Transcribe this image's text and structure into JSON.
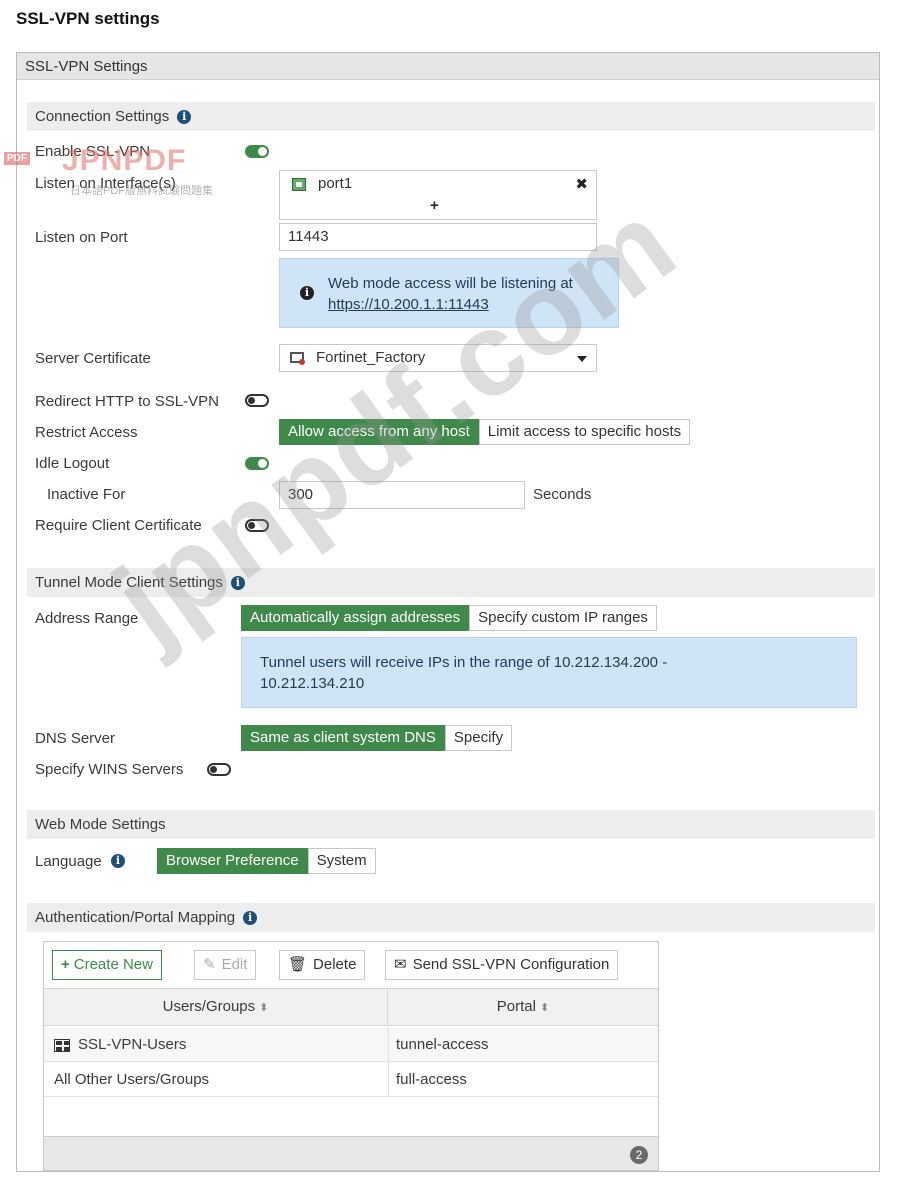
{
  "page_title": "SSL-VPN settings",
  "panel_header": "SSL-VPN Settings",
  "connection": {
    "section_title": "Connection Settings",
    "enable_label": "Enable SSL-VPN",
    "listen_interface_label": "Listen on Interface(s)",
    "interface_value": "port1",
    "add_symbol": "+",
    "remove_symbol": "✖",
    "listen_port_label": "Listen on Port",
    "listen_port_value": "11443",
    "info_text": "Web mode access will be listening at",
    "info_link": "https://10.200.1.1:11443",
    "server_cert_label": "Server Certificate",
    "server_cert_value": "Fortinet_Factory",
    "redirect_label": "Redirect HTTP to SSL-VPN",
    "restrict_label": "Restrict Access",
    "restrict_options": [
      "Allow access from any host",
      "Limit access to specific hosts"
    ],
    "idle_logout_label": "Idle Logout",
    "inactive_for_label": "Inactive For",
    "inactive_for_value": "300",
    "inactive_for_unit": "Seconds",
    "require_cert_label": "Require Client Certificate"
  },
  "tunnel": {
    "section_title": "Tunnel Mode Client Settings",
    "address_range_label": "Address Range",
    "address_options": [
      "Automatically assign addresses",
      "Specify custom IP ranges"
    ],
    "info_line1": "Tunnel users will receive IPs in the range of 10.212.134.200 -",
    "info_line2": "10.212.134.210",
    "dns_label": "DNS Server",
    "dns_options": [
      "Same as client system DNS",
      "Specify"
    ],
    "wins_label": "Specify WINS Servers"
  },
  "web": {
    "section_title": "Web Mode Settings",
    "language_label": "Language",
    "language_options": [
      "Browser Preference",
      "System"
    ]
  },
  "auth": {
    "section_title": "Authentication/Portal Mapping",
    "buttons": {
      "create": "Create New",
      "edit": "Edit",
      "delete": "Delete",
      "send": "Send SSL-VPN Configuration"
    },
    "columns": [
      "Users/Groups",
      "Portal"
    ],
    "rows": [
      {
        "users": "SSL-VPN-Users",
        "portal": "tunnel-access"
      },
      {
        "users": "All Other Users/Groups",
        "portal": "full-access"
      }
    ],
    "count": "2"
  },
  "watermarks": {
    "logo_text": "JPNPDF",
    "logo_prefix": "PDF",
    "logo_sub": "日本語PDF版無料試験問題集",
    "diagonal_text": "jpnpdf.com"
  },
  "colors": {
    "accent_green": "#3f8a4a",
    "info_blue": "#cfe5f7",
    "section_gray": "#ededed"
  }
}
